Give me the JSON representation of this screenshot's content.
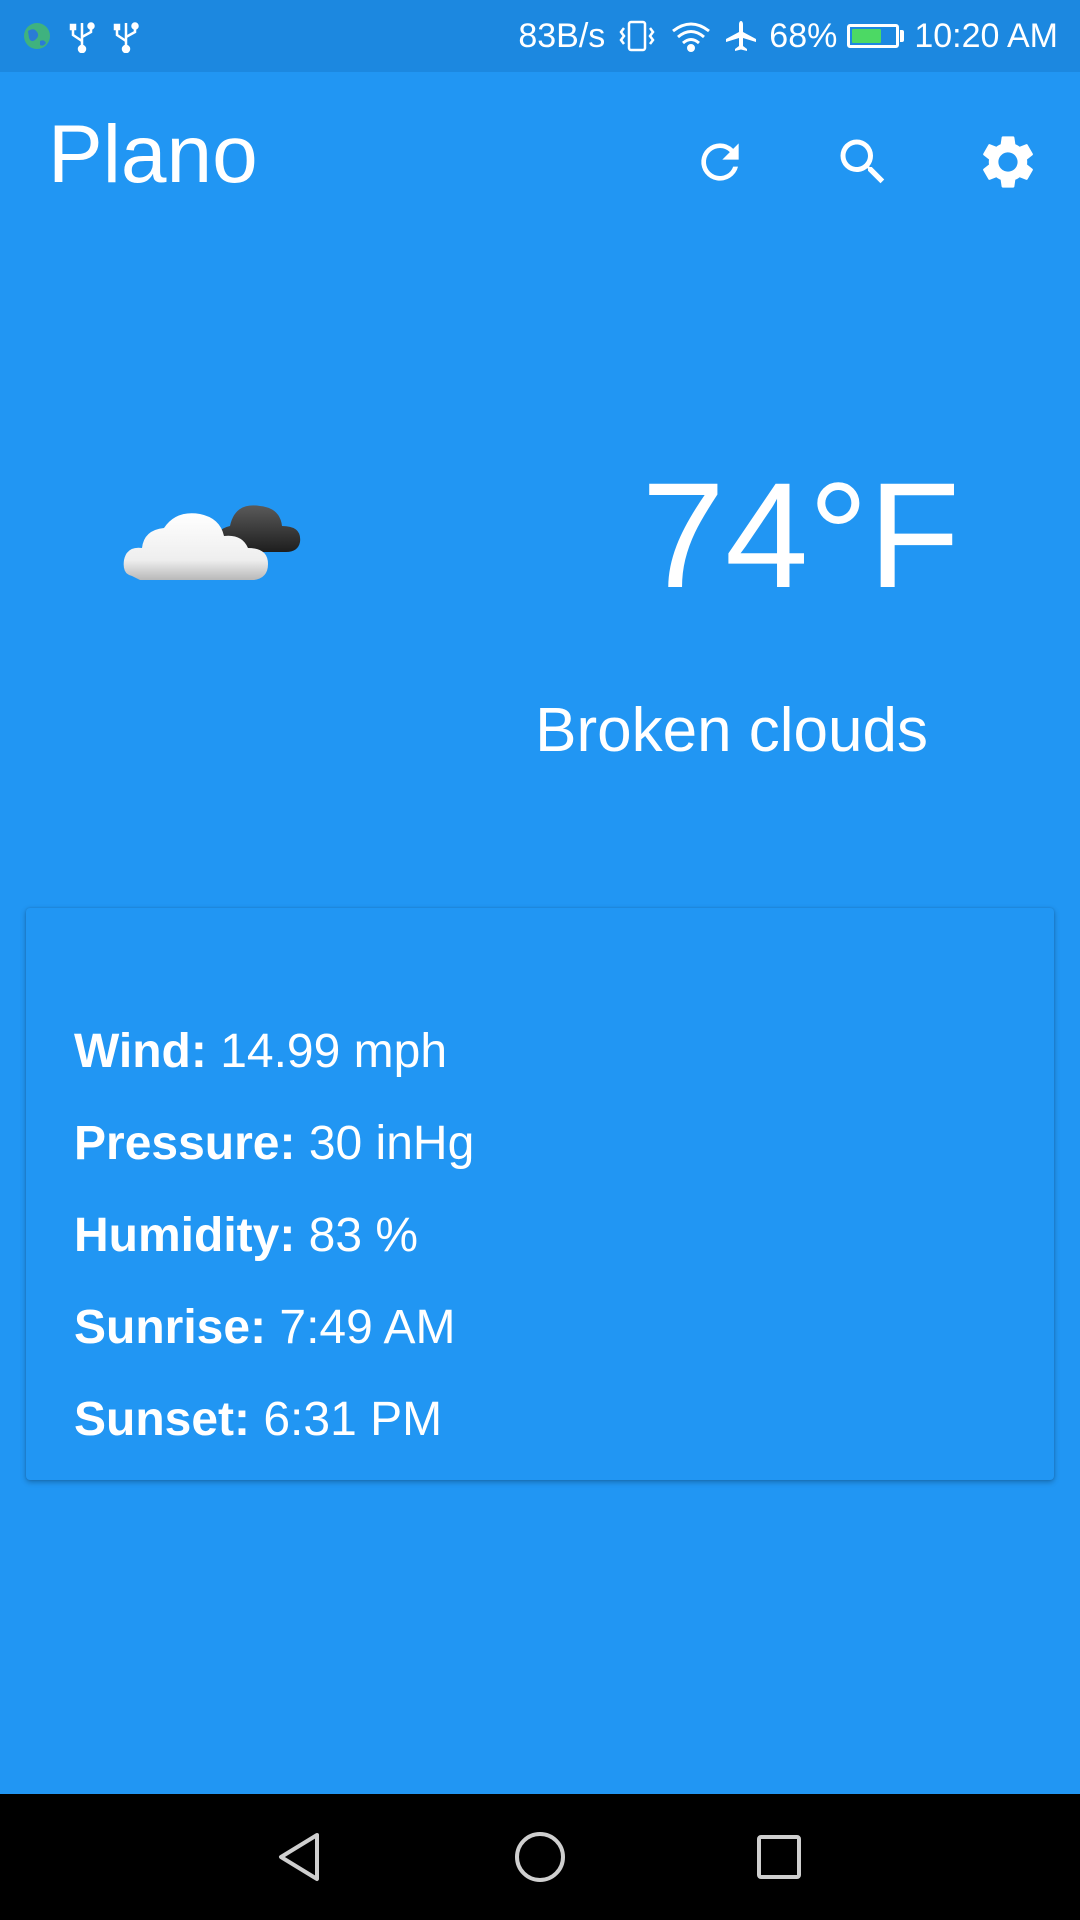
{
  "status_bar": {
    "network_speed": "83B/s",
    "battery_percent": "68%",
    "battery_level": 0.68,
    "time": "10:20 AM",
    "icons": [
      "globe-icon",
      "usb-icon",
      "usb-icon",
      "vibrate-icon",
      "wifi-icon",
      "airplane-icon",
      "battery-charging-icon"
    ]
  },
  "app_bar": {
    "title": "Plano",
    "actions": [
      "refresh-icon",
      "search-icon",
      "settings-icon"
    ]
  },
  "weather": {
    "icon": "broken-clouds-icon",
    "temperature": "74°F",
    "description": "Broken clouds"
  },
  "details": {
    "wind_label": "Wind:",
    "wind_value": "14.99 mph",
    "pressure_label": "Pressure:",
    "pressure_value": "30 inHg",
    "humidity_label": "Humidity:",
    "humidity_value": "83 %",
    "sunrise_label": "Sunrise:",
    "sunrise_value": "7:49 AM",
    "sunset_label": "Sunset:",
    "sunset_value": "6:31 PM"
  },
  "nav_bar": {
    "buttons": [
      "back-icon",
      "home-icon",
      "recents-icon"
    ]
  },
  "colors": {
    "background": "#2196f3",
    "status_bar": "#1c88e0",
    "text": "#ffffff",
    "battery_fill": "#4cd964"
  }
}
